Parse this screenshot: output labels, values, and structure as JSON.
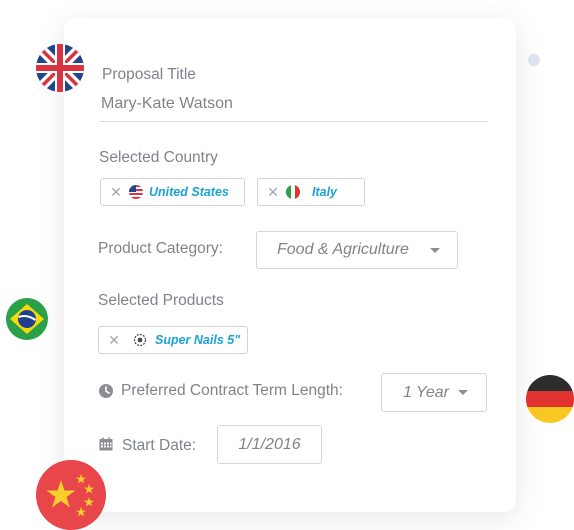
{
  "form": {
    "proposal_title_label": "Proposal Title",
    "proposal_title_value": "Mary-Kate Watson",
    "selected_country_label": "Selected Country",
    "countries": [
      {
        "name": "United States",
        "flag": "us-flag"
      },
      {
        "name": "Italy",
        "flag": "italy-flag"
      }
    ],
    "product_category_label": "Product Category:",
    "product_category_value": "Food & Agriculture",
    "selected_products_label": "Selected Products",
    "products": [
      {
        "name": "Super Nails 5\"",
        "icon": "nail-product-icon"
      }
    ],
    "contract_term_label": "Preferred Contract Term Length:",
    "contract_term_value": "1 Year",
    "start_date_label": "Start Date:",
    "start_date_value": "1/1/2016"
  },
  "remove_glyph": "✕",
  "decor_flags": [
    "uk-flag",
    "brazil-flag",
    "germany-flag",
    "china-flag"
  ],
  "colors": {
    "accent": "#1aa3d6",
    "text": "#80838b",
    "border": "#d4d6dc"
  }
}
